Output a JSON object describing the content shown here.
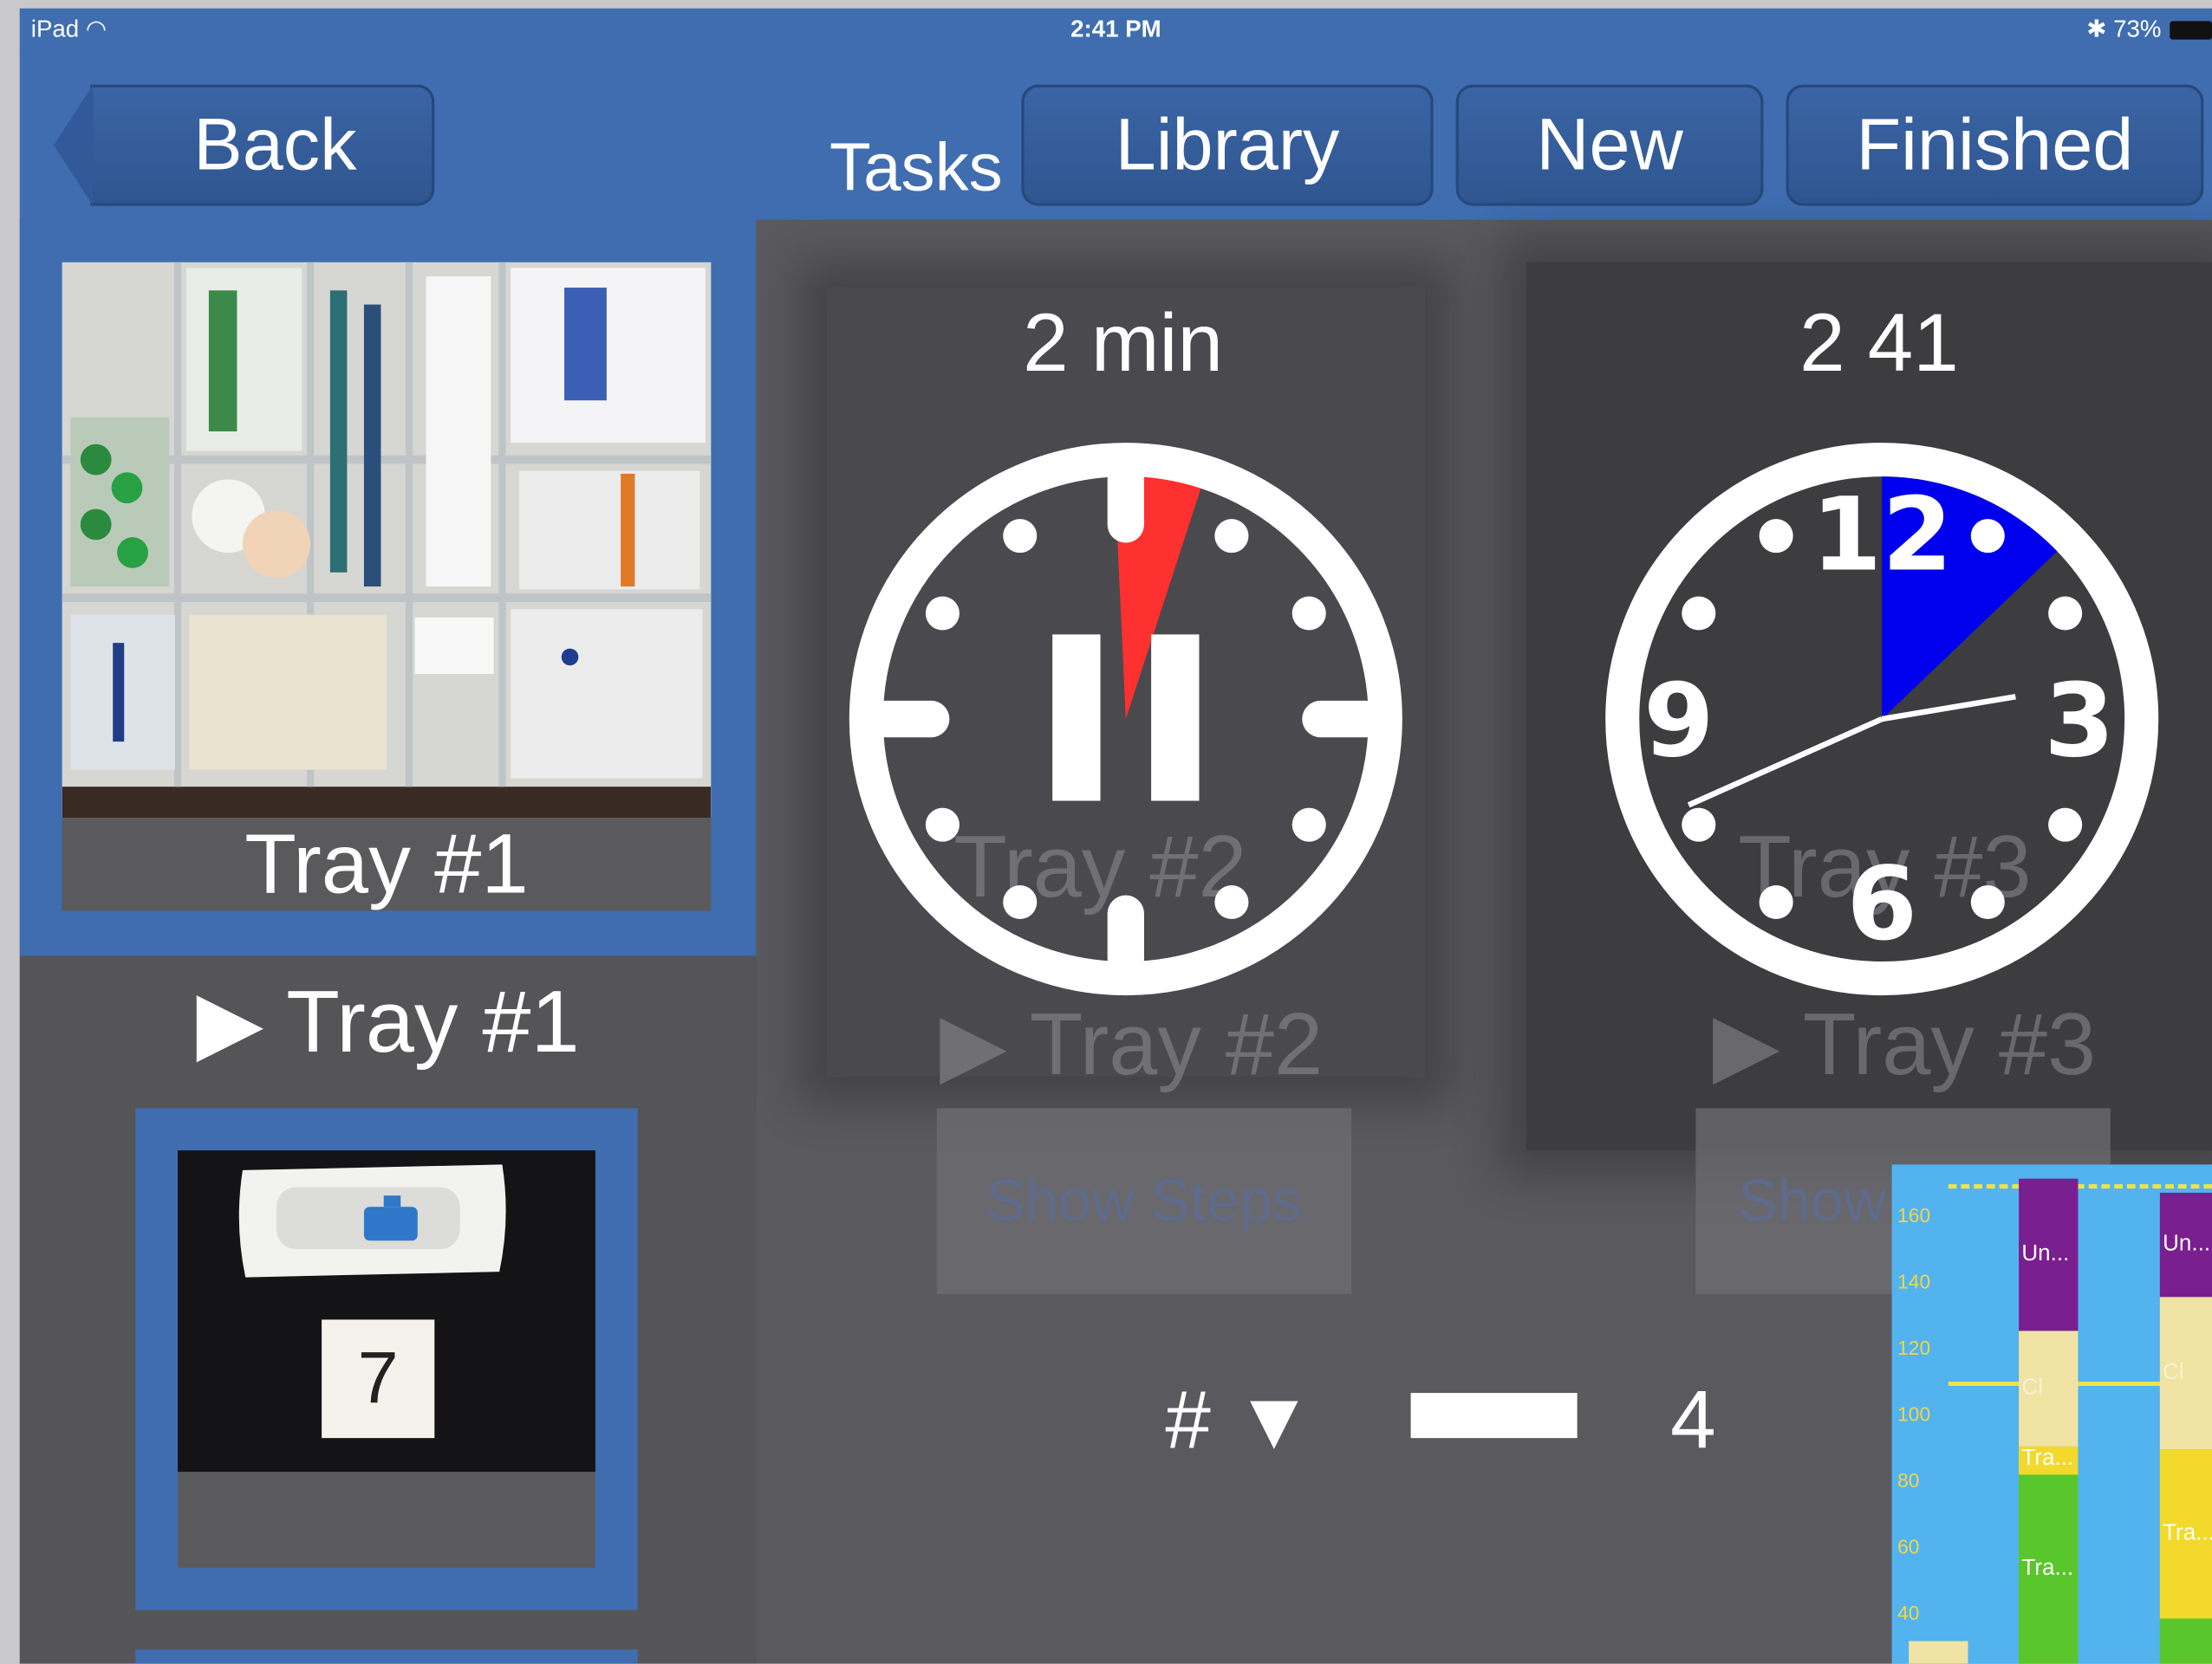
{
  "status": {
    "device": "iPad",
    "time": "2:41 PM",
    "battery": "73%"
  },
  "nav": {
    "back": "Back",
    "tasks": "Tasks",
    "library": "Library",
    "new": "New",
    "finished": "Finished"
  },
  "sidebar": {
    "selected_label": "Tray #1",
    "play_label": "▶ Tray #1",
    "step_number": "7"
  },
  "main": {
    "timer_title": "2 min",
    "clock_title": "2 41",
    "timer_fraction_elapsed": 0.05,
    "ghost_tray2_label": "Tray #2",
    "ghost_tray2_play": "▶ Tray #2",
    "ghost_tray3_label": "Tray #3",
    "ghost_tray3_play": "▶ Tray #3",
    "show_steps": "Show Steps",
    "show_partial": "Show",
    "count_label": "# ▼",
    "count_value": "4"
  },
  "clock": {
    "n12": "12",
    "n3": "3",
    "n6": "6",
    "n9": "9",
    "hour": 2,
    "minute": 41
  },
  "mini_chart": {
    "ticks": [
      "160",
      "140",
      "120",
      "100",
      "80",
      "60",
      "40"
    ],
    "segments": [
      "Un...",
      "Cl",
      "Tra...",
      "Tra...",
      "Un...",
      "Cl",
      "Tra..."
    ]
  },
  "colors": {
    "accent": "#3f6db0",
    "timer_wedge": "#ff3030",
    "clock_wedge": "#0000ee"
  }
}
